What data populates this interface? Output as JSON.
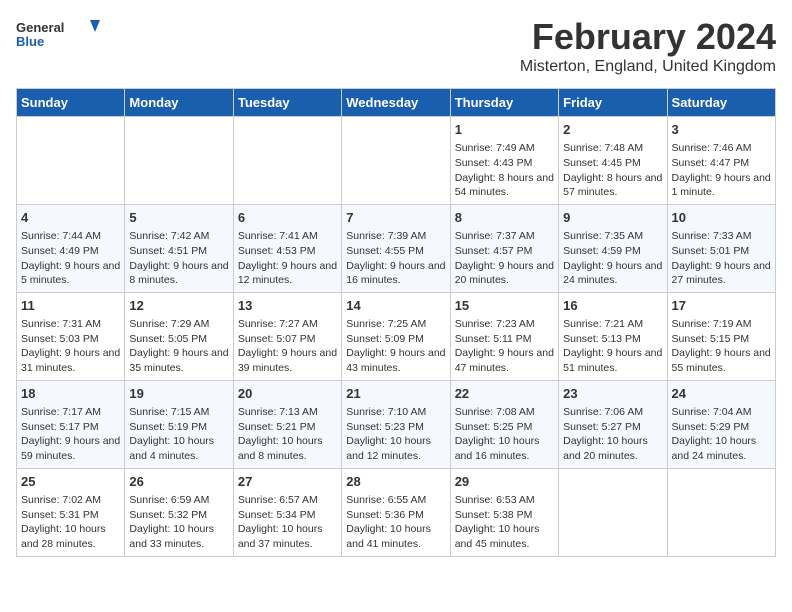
{
  "logo": {
    "line1": "General",
    "line2": "Blue"
  },
  "title": "February 2024",
  "subtitle": "Misterton, England, United Kingdom",
  "days_header": [
    "Sunday",
    "Monday",
    "Tuesday",
    "Wednesday",
    "Thursday",
    "Friday",
    "Saturday"
  ],
  "weeks": [
    [
      {
        "day": "",
        "empty": true
      },
      {
        "day": "",
        "empty": true
      },
      {
        "day": "",
        "empty": true
      },
      {
        "day": "",
        "empty": true
      },
      {
        "day": "1",
        "sunrise": "7:49 AM",
        "sunset": "4:43 PM",
        "daylight": "8 hours and 54 minutes."
      },
      {
        "day": "2",
        "sunrise": "7:48 AM",
        "sunset": "4:45 PM",
        "daylight": "8 hours and 57 minutes."
      },
      {
        "day": "3",
        "sunrise": "7:46 AM",
        "sunset": "4:47 PM",
        "daylight": "9 hours and 1 minute."
      }
    ],
    [
      {
        "day": "4",
        "sunrise": "7:44 AM",
        "sunset": "4:49 PM",
        "daylight": "9 hours and 5 minutes."
      },
      {
        "day": "5",
        "sunrise": "7:42 AM",
        "sunset": "4:51 PM",
        "daylight": "9 hours and 8 minutes."
      },
      {
        "day": "6",
        "sunrise": "7:41 AM",
        "sunset": "4:53 PM",
        "daylight": "9 hours and 12 minutes."
      },
      {
        "day": "7",
        "sunrise": "7:39 AM",
        "sunset": "4:55 PM",
        "daylight": "9 hours and 16 minutes."
      },
      {
        "day": "8",
        "sunrise": "7:37 AM",
        "sunset": "4:57 PM",
        "daylight": "9 hours and 20 minutes."
      },
      {
        "day": "9",
        "sunrise": "7:35 AM",
        "sunset": "4:59 PM",
        "daylight": "9 hours and 24 minutes."
      },
      {
        "day": "10",
        "sunrise": "7:33 AM",
        "sunset": "5:01 PM",
        "daylight": "9 hours and 27 minutes."
      }
    ],
    [
      {
        "day": "11",
        "sunrise": "7:31 AM",
        "sunset": "5:03 PM",
        "daylight": "9 hours and 31 minutes."
      },
      {
        "day": "12",
        "sunrise": "7:29 AM",
        "sunset": "5:05 PM",
        "daylight": "9 hours and 35 minutes."
      },
      {
        "day": "13",
        "sunrise": "7:27 AM",
        "sunset": "5:07 PM",
        "daylight": "9 hours and 39 minutes."
      },
      {
        "day": "14",
        "sunrise": "7:25 AM",
        "sunset": "5:09 PM",
        "daylight": "9 hours and 43 minutes."
      },
      {
        "day": "15",
        "sunrise": "7:23 AM",
        "sunset": "5:11 PM",
        "daylight": "9 hours and 47 minutes."
      },
      {
        "day": "16",
        "sunrise": "7:21 AM",
        "sunset": "5:13 PM",
        "daylight": "9 hours and 51 minutes."
      },
      {
        "day": "17",
        "sunrise": "7:19 AM",
        "sunset": "5:15 PM",
        "daylight": "9 hours and 55 minutes."
      }
    ],
    [
      {
        "day": "18",
        "sunrise": "7:17 AM",
        "sunset": "5:17 PM",
        "daylight": "9 hours and 59 minutes."
      },
      {
        "day": "19",
        "sunrise": "7:15 AM",
        "sunset": "5:19 PM",
        "daylight": "10 hours and 4 minutes."
      },
      {
        "day": "20",
        "sunrise": "7:13 AM",
        "sunset": "5:21 PM",
        "daylight": "10 hours and 8 minutes."
      },
      {
        "day": "21",
        "sunrise": "7:10 AM",
        "sunset": "5:23 PM",
        "daylight": "10 hours and 12 minutes."
      },
      {
        "day": "22",
        "sunrise": "7:08 AM",
        "sunset": "5:25 PM",
        "daylight": "10 hours and 16 minutes."
      },
      {
        "day": "23",
        "sunrise": "7:06 AM",
        "sunset": "5:27 PM",
        "daylight": "10 hours and 20 minutes."
      },
      {
        "day": "24",
        "sunrise": "7:04 AM",
        "sunset": "5:29 PM",
        "daylight": "10 hours and 24 minutes."
      }
    ],
    [
      {
        "day": "25",
        "sunrise": "7:02 AM",
        "sunset": "5:31 PM",
        "daylight": "10 hours and 28 minutes."
      },
      {
        "day": "26",
        "sunrise": "6:59 AM",
        "sunset": "5:32 PM",
        "daylight": "10 hours and 33 minutes."
      },
      {
        "day": "27",
        "sunrise": "6:57 AM",
        "sunset": "5:34 PM",
        "daylight": "10 hours and 37 minutes."
      },
      {
        "day": "28",
        "sunrise": "6:55 AM",
        "sunset": "5:36 PM",
        "daylight": "10 hours and 41 minutes."
      },
      {
        "day": "29",
        "sunrise": "6:53 AM",
        "sunset": "5:38 PM",
        "daylight": "10 hours and 45 minutes."
      },
      {
        "day": "",
        "empty": true
      },
      {
        "day": "",
        "empty": true
      }
    ]
  ]
}
